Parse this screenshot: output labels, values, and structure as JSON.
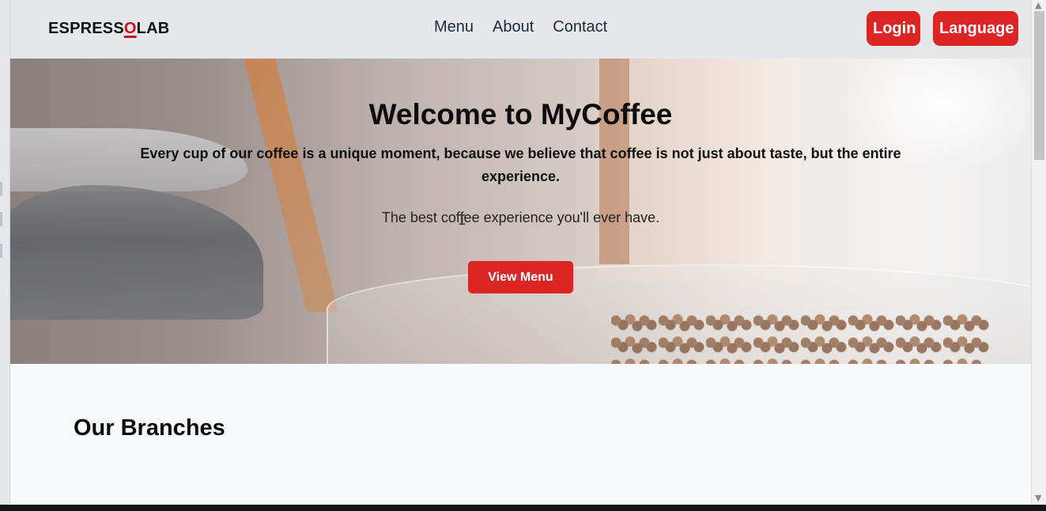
{
  "navbar": {
    "brand_before": "ESPRESS",
    "brand_o": "O",
    "brand_after": "LAB",
    "links": [
      "Menu",
      "About",
      "Contact"
    ],
    "login_label": "Login",
    "language_label": "Language"
  },
  "hero": {
    "title": "Welcome to MyCoffee",
    "subtitle": "Every cup of our coffee is a unique moment, because we believe that coffee is not just about taste, but the entire experience.",
    "tagline": "The best coffee experience you'll ever have.",
    "cta_label": "View Menu"
  },
  "sections": {
    "branches_title": "Our Branches"
  },
  "colors": {
    "accent": "#dc2626",
    "navbar_bg": "#e5e7eb",
    "page_bg": "#f8f9fb"
  }
}
